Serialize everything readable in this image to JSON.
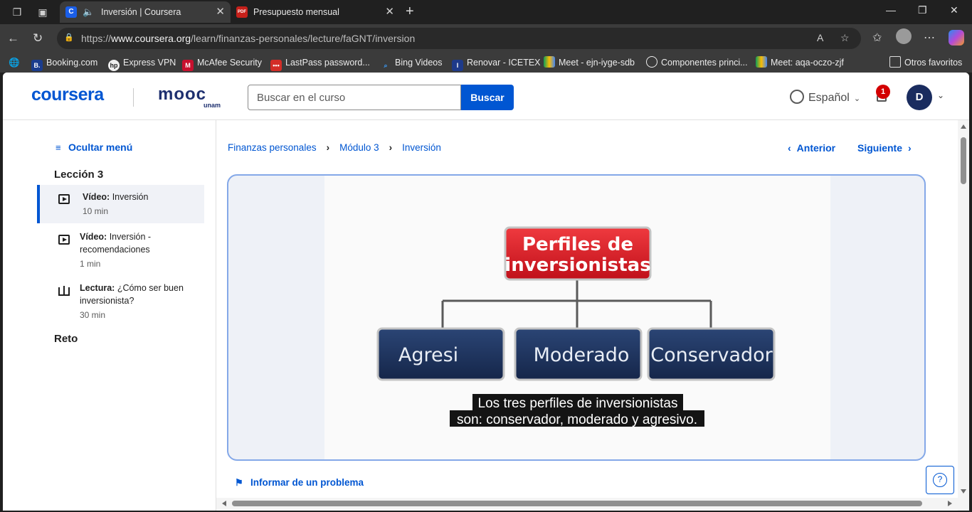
{
  "browser": {
    "tabs": [
      {
        "title": "Inversión | Coursera",
        "favicon": "C",
        "active": true,
        "muted_audio_icon": "speaker-icon"
      },
      {
        "title": "Presupuesto mensual",
        "favicon": "PDF",
        "active": false
      }
    ],
    "url": {
      "prefix": "https://",
      "domain": "www.coursera.org",
      "path": "/learn/finanzas-personales/lecture/faGNT/inversion"
    },
    "favorites": [
      {
        "label": "Booking.com",
        "icon": "B."
      },
      {
        "label": "Express VPN",
        "icon": "hp"
      },
      {
        "label": "McAfee Security",
        "icon": "M"
      },
      {
        "label": "LastPass password...",
        "icon": "•••"
      },
      {
        "label": "Bing Videos",
        "icon": "search-icon"
      },
      {
        "label": "Renovar - ICETEX",
        "icon": "I"
      },
      {
        "label": "Meet - ejn-iyge-sdb",
        "icon": "meet-icon"
      },
      {
        "label": "Componentes princi...",
        "icon": "openai-icon"
      },
      {
        "label": "Meet: aqa-oczo-zjf",
        "icon": "meet-icon"
      }
    ],
    "other_favorites": "Otros favoritos"
  },
  "header": {
    "logo": "coursera",
    "partner_logo": "mooc",
    "partner_sub": "unam",
    "search_placeholder": "Buscar en el curso",
    "search_button": "Buscar",
    "language": "Español",
    "notification_count": "1",
    "avatar_initial": "D"
  },
  "sidebar": {
    "hide_menu": "Ocultar menú",
    "lesson_title": "Lección 3",
    "items": [
      {
        "type_label": "Vídeo:",
        "title": "Inversión",
        "duration": "10 min",
        "icon": "video-icon",
        "active": true
      },
      {
        "type_label": "Vídeo:",
        "title": "Inversión - recomendaciones",
        "duration": "1 min",
        "icon": "video-icon",
        "active": false
      },
      {
        "type_label": "Lectura:",
        "title": "¿Cómo ser buen inversionista?",
        "duration": "30 min",
        "icon": "book-icon",
        "active": false
      }
    ],
    "next_section": "Reto"
  },
  "main": {
    "breadcrumb": [
      "Finanzas personales",
      "Módulo 3",
      "Inversión"
    ],
    "prev_label": "Anterior",
    "next_label": "Siguiente",
    "video": {
      "slide_title_line1": "Perfiles de",
      "slide_title_line2": "inversionistas",
      "profiles": [
        "Agresi",
        "Moderado",
        "Conservador"
      ],
      "subtitle_line1": "Los tres perfiles de inversionistas",
      "subtitle_line2": "son: conservador, moderado y agresivo."
    },
    "report_problem": "Informar de un problema"
  },
  "colors": {
    "brand": "#0056d2",
    "slide_red": "#d7161f",
    "slide_navy": "#1b3157"
  }
}
